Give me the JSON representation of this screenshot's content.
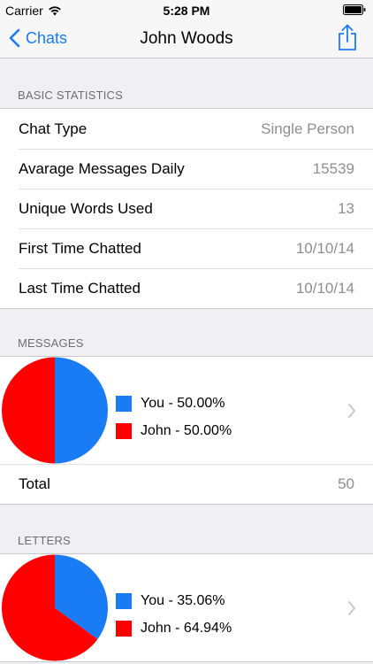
{
  "status": {
    "carrier": "Carrier",
    "time": "5:28 PM"
  },
  "nav": {
    "back_label": "Chats",
    "title": "John Woods"
  },
  "colors": {
    "accent": "#1a7cf5",
    "you": "#1a7cf5",
    "john": "#ff0000"
  },
  "basic": {
    "header": "BASIC STATISTICS",
    "rows": [
      {
        "label": "Chat Type",
        "value": "Single Person"
      },
      {
        "label": "Avarage Messages Daily",
        "value": "15539"
      },
      {
        "label": "Unique Words Used",
        "value": "13"
      },
      {
        "label": "First Time Chatted",
        "value": "10/10/14"
      },
      {
        "label": "Last Time Chatted",
        "value": "10/10/14"
      }
    ]
  },
  "messages": {
    "header": "MESSAGES",
    "legend": [
      {
        "label": "You - 50.00%"
      },
      {
        "label": "John - 50.00%"
      }
    ],
    "total_label": "Total",
    "total_value": "50"
  },
  "letters": {
    "header": "LETTERS",
    "legend": [
      {
        "label": "You - 35.06%"
      },
      {
        "label": "John - 64.94%"
      }
    ]
  },
  "chart_data": [
    {
      "type": "pie",
      "categories": [
        "You",
        "John"
      ],
      "values": [
        50.0,
        50.0
      ]
    },
    {
      "type": "pie",
      "categories": [
        "You",
        "John"
      ],
      "values": [
        35.06,
        64.94
      ]
    }
  ]
}
